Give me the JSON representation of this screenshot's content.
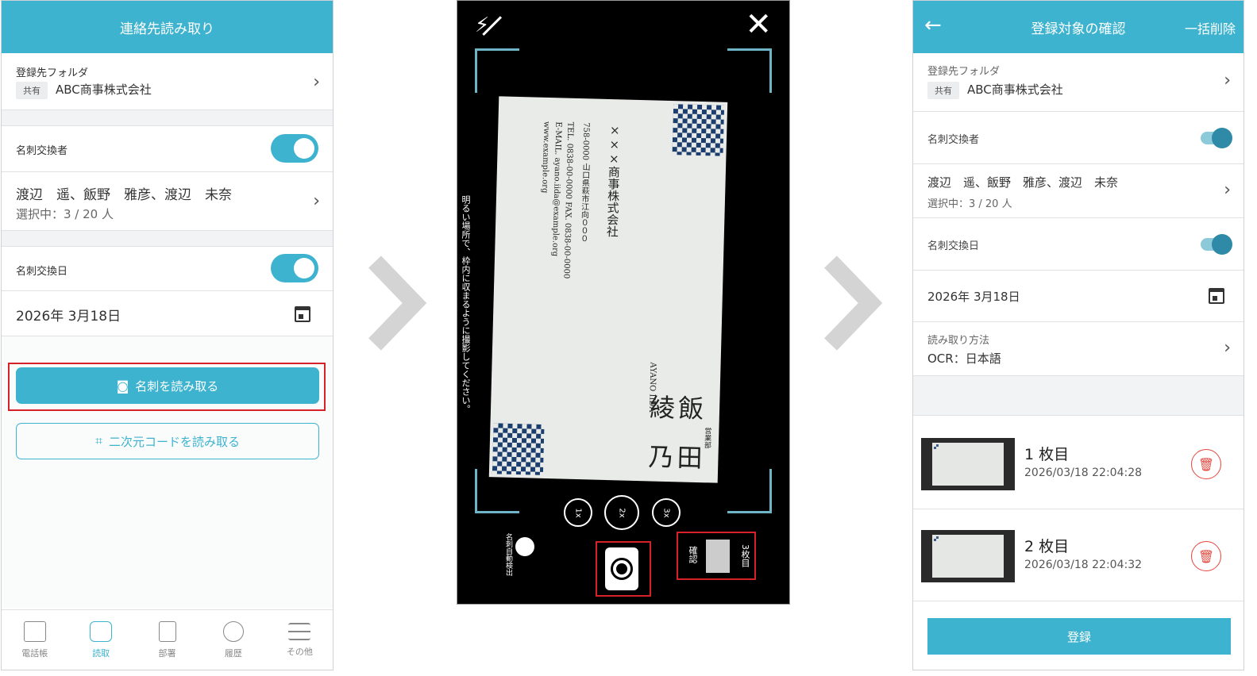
{
  "screen1": {
    "title": "連絡先読み取り",
    "folder_label": "登録先フォルダ",
    "folder_tag": "共有",
    "folder_name": "ABC商事株式会社",
    "exchanger_label": "名刺交換者",
    "exchanger_names": "渡辺　遥、飯野　雅彦、渡辺　未奈",
    "exchanger_count": "選択中：3 / 20 人",
    "date_label": "名刺交換日",
    "date_value": "2026年 3月18日",
    "scan_button": "名刺を読み取る",
    "qr_button": "二次元コードを読み取る",
    "tabs": [
      {
        "label": "電話帳",
        "icon": "phonebook-icon"
      },
      {
        "label": "読取",
        "icon": "camera-icon"
      },
      {
        "label": "部署",
        "icon": "building-icon"
      },
      {
        "label": "履歴",
        "icon": "clock-icon"
      },
      {
        "label": "その他",
        "icon": "menu-icon"
      }
    ]
  },
  "screen2": {
    "hint": "明るい場所で、枠内に収まるように撮影してください。",
    "card_company": "×××商事株式会社",
    "card_address": "758-0000 山口県萩市江向０００",
    "card_tel": "TEL. 0838-00-0000 FAX. 0838-00-0000",
    "card_email": "E-MAIL. ayano.iida@example.org",
    "card_web": "www.example.org",
    "card_romaji": "AYANO IIDA",
    "card_name": "飯 田 綾 乃",
    "card_dept": "営業部",
    "zoom_1": "1x",
    "zoom_2": "2x",
    "zoom_3": "3x",
    "auto_detect": "名刺自動検出",
    "confirm": "確認",
    "count": "3枚目"
  },
  "screen3": {
    "title": "登録対象の確認",
    "delete_all": "一括削除",
    "folder_label": "登録先フォルダ",
    "folder_tag": "共有",
    "folder_name": "ABC商事株式会社",
    "exchanger_label": "名刺交換者",
    "exchanger_names": "渡辺　遥、飯野　雅彦、渡辺　未奈",
    "exchanger_count": "選択中：3 / 20 人",
    "date_label": "名刺交換日",
    "date_value": "2026年 3月18日",
    "method_label": "読み取り方法",
    "method_value": "OCR：日本語",
    "items": [
      {
        "title": "1 枚目",
        "time": "2026/03/18 22:04:28"
      },
      {
        "title": "2 枚目",
        "time": "2026/03/18 22:04:32"
      }
    ],
    "register_button": "登録"
  },
  "colors": {
    "accent": "#3db3cf",
    "highlight": "#d6202a",
    "delete": "#e2473e"
  }
}
